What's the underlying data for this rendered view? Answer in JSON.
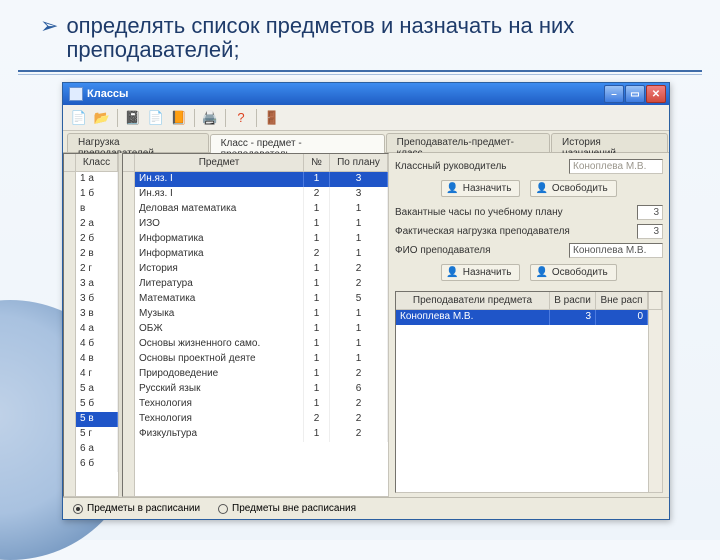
{
  "bullet": {
    "text": "определять список предметов и назначать на них преподавателей;"
  },
  "window": {
    "title": "Классы",
    "tabs": [
      "Нагрузка преподавателей",
      "Класс - предмет - преподаватель",
      "Преподаватель-предмет-класс",
      "История назначений"
    ],
    "activeTab": 1,
    "classHeader": "Класс",
    "subjectHeaders": {
      "name": "Предмет",
      "num": "№",
      "plan": "По плану"
    },
    "classes": [
      "1 а",
      "1 б",
      "в",
      "2 а",
      "2 б",
      "2 в",
      "2 г",
      "3 а",
      "3 б",
      "3 в",
      "4 а",
      "4 б",
      "4 в",
      "4 г",
      "5 а",
      "5 б",
      "5 в",
      "5 г",
      "6 а",
      "6 б"
    ],
    "classSelected": 16,
    "subjects": [
      {
        "name": "Ин.яз. I",
        "n": "1",
        "plan": "3"
      },
      {
        "name": "Ин.яз. I",
        "n": "2",
        "plan": "3"
      },
      {
        "name": "Деловая математика",
        "n": "1",
        "plan": "1"
      },
      {
        "name": "ИЗО",
        "n": "1",
        "plan": "1"
      },
      {
        "name": "Информатика",
        "n": "1",
        "plan": "1"
      },
      {
        "name": "Информатика",
        "n": "2",
        "plan": "1"
      },
      {
        "name": "История",
        "n": "1",
        "plan": "2"
      },
      {
        "name": "Литература",
        "n": "1",
        "plan": "2"
      },
      {
        "name": "Математика",
        "n": "1",
        "plan": "5"
      },
      {
        "name": "Музыка",
        "n": "1",
        "plan": "1"
      },
      {
        "name": "ОБЖ",
        "n": "1",
        "plan": "1"
      },
      {
        "name": "Основы жизненного само.",
        "n": "1",
        "plan": "1"
      },
      {
        "name": "Основы проектной деяте",
        "n": "1",
        "plan": "1"
      },
      {
        "name": "Природоведение",
        "n": "1",
        "plan": "2"
      },
      {
        "name": "Русский язык",
        "n": "1",
        "plan": "6"
      },
      {
        "name": "Технология",
        "n": "1",
        "plan": "2"
      },
      {
        "name": "Технология",
        "n": "2",
        "plan": "2"
      },
      {
        "name": "Физкультура",
        "n": "1",
        "plan": "2"
      }
    ],
    "subjectSelected": 0,
    "right": {
      "classTeacherLabel": "Классный руководитель",
      "classTeacherValue": "Коноплева М.В.",
      "assign": "Назначить",
      "release": "Освободить",
      "vacantLabel": "Вакантные часы по учебному плану",
      "vacantValue": "3",
      "loadLabel": "Фактическая нагрузка преподавателя",
      "loadValue": "3",
      "fioLabel": "ФИО преподавателя",
      "fioValue": "Коноплева М.В.",
      "teacherHeaders": {
        "name": "Преподаватели предмета",
        "in": "В распи",
        "out": "Вне расп"
      },
      "teachers": [
        {
          "name": "Коноплева М.В.",
          "in": "3",
          "out": "0"
        }
      ]
    },
    "footer": {
      "opt1": "Предметы в расписании",
      "opt2": "Предметы вне расписания",
      "selected": 0
    }
  },
  "icons": {
    "tb": [
      "new",
      "open",
      "page-purple",
      "page-gray",
      "page-brown",
      "print",
      "help",
      "exit"
    ]
  }
}
